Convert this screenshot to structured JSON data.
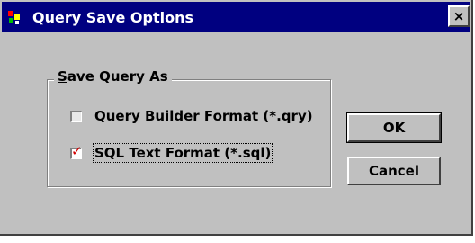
{
  "window": {
    "title": "Query Save Options",
    "close_label": "×",
    "icon": "app-sql-icon"
  },
  "group": {
    "label_underlined": "S",
    "label_rest": "ave Query As"
  },
  "options": [
    {
      "label": "Query Builder Format (*.qry)",
      "checked": false
    },
    {
      "label": "SQL Text Format (*.sql)",
      "checked": true,
      "check_glyph": "✓"
    }
  ],
  "buttons": {
    "ok": "OK",
    "cancel": "Cancel"
  },
  "colors": {
    "titlebar": "#000080",
    "face": "#c0c0c0",
    "checkmark": "#d40000"
  }
}
